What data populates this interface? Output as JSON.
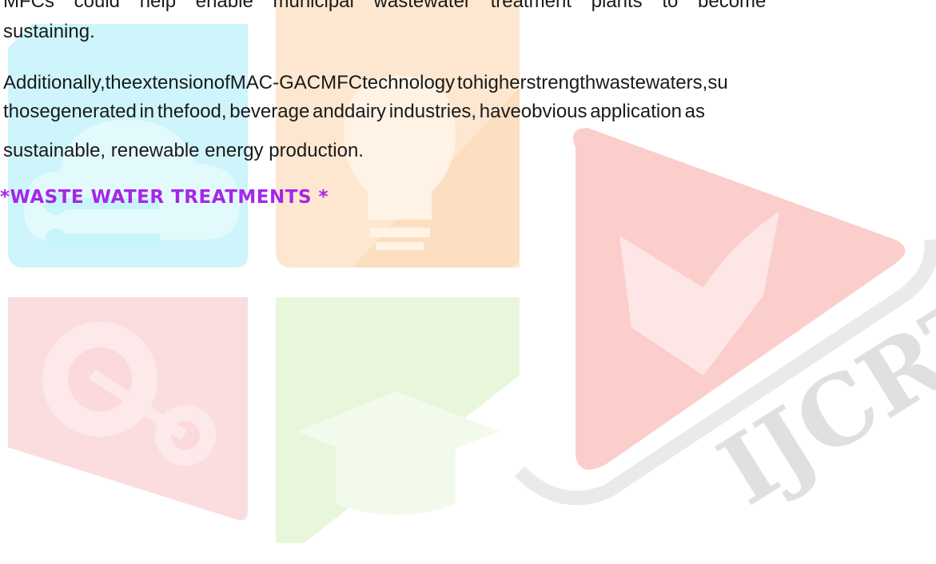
{
  "document": {
    "paragraph_1": {
      "line_1": "MFCs could help enable municipal wastewater treatment plants to become",
      "line_2": "sustaining."
    },
    "paragraph_2": {
      "line_1": "Additionally,theextensionofMAC-GACMFCtechnology tohigherstrengthwastewaters,su",
      "line_2": "thosegenerated in thefood, beverage anddairy industries, haveobvious application as",
      "line_3": "sustainable, renewable energy production."
    },
    "section_heading": "*WASTE WATER TREATMENTS *"
  },
  "watermark": {
    "brand": "IJCRT",
    "colors": {
      "cyan": "#c8f4fb",
      "orange": "#fde4cb",
      "pink": "#fbd9dc",
      "green": "#e5f6d8",
      "red": "#fbc9c6",
      "gray": "#d9d9d9"
    }
  }
}
